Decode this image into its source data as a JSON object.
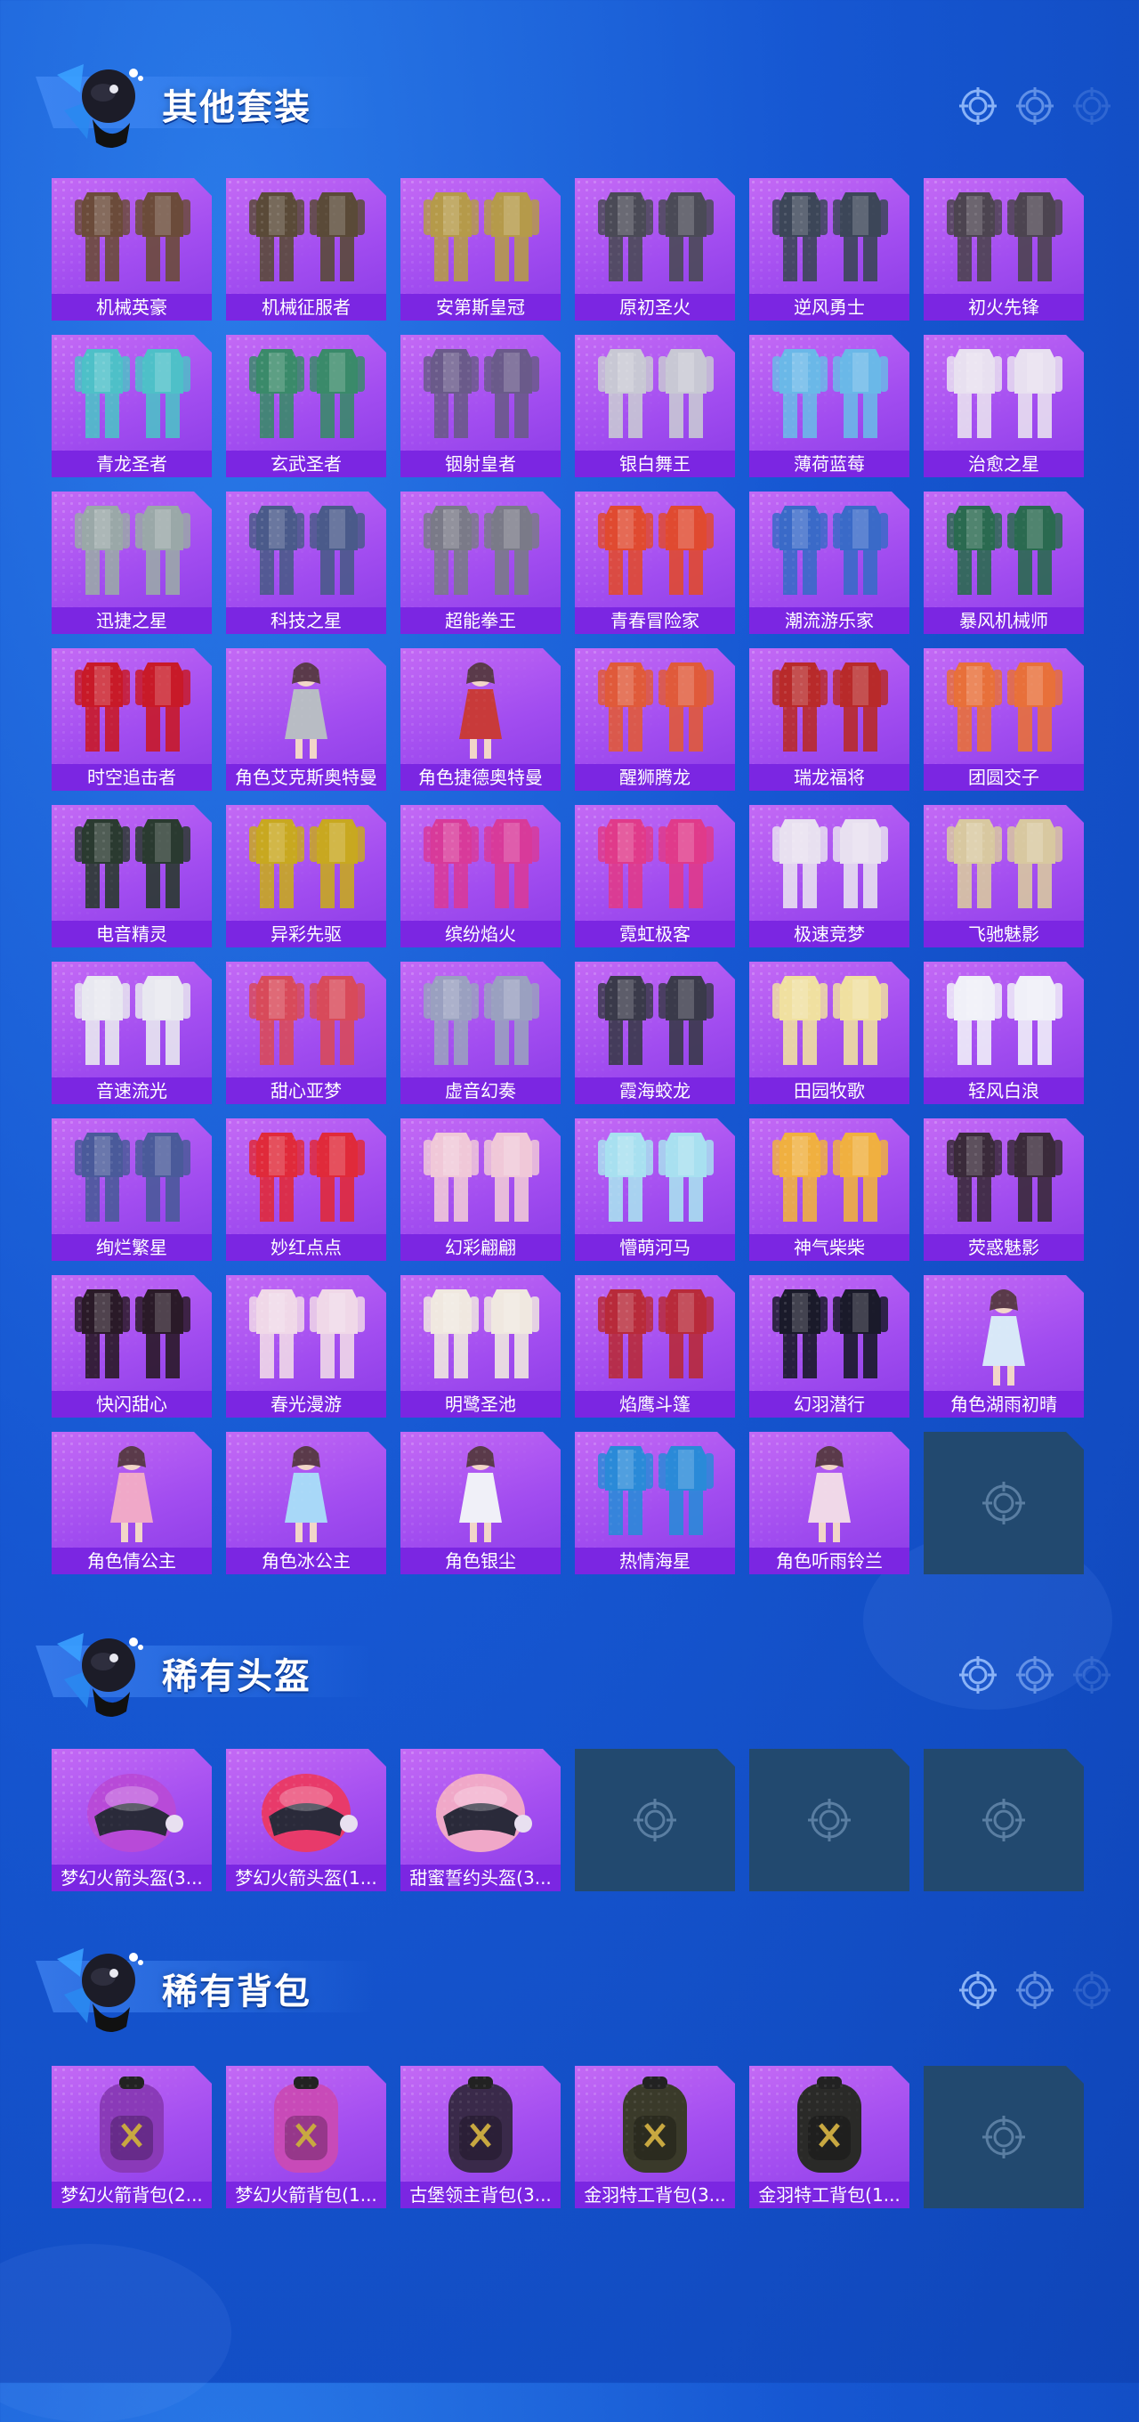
{
  "colors": {
    "background": "#1657d2",
    "card": "#a24df0",
    "label_bar": "#7b26e2",
    "empty_slot": "#22496f"
  },
  "sections": [
    {
      "title": "其他套装",
      "items": [
        {
          "label": "机械英豪",
          "type": "outfit",
          "tone": "#6b4b3a"
        },
        {
          "label": "机械征服者",
          "type": "outfit",
          "tone": "#5a4a38"
        },
        {
          "label": "安第斯皇冠",
          "type": "outfit",
          "tone": "#b59a4a"
        },
        {
          "label": "原初圣火",
          "type": "outfit",
          "tone": "#4a4a56"
        },
        {
          "label": "逆风勇士",
          "type": "outfit",
          "tone": "#3c4658"
        },
        {
          "label": "初火先锋",
          "type": "outfit",
          "tone": "#4c4450"
        },
        {
          "label": "青龙圣者",
          "type": "outfit",
          "tone": "#4ec0c8"
        },
        {
          "label": "玄武圣者",
          "type": "outfit",
          "tone": "#3a8a6a"
        },
        {
          "label": "铟射皇者",
          "type": "outfit",
          "tone": "#6a5a8a"
        },
        {
          "label": "银白舞王",
          "type": "outfit",
          "tone": "#c8c8d4"
        },
        {
          "label": "薄荷蓝莓",
          "type": "outfit",
          "tone": "#6ab8e8"
        },
        {
          "label": "治愈之星",
          "type": "outfit",
          "tone": "#e8e0f0"
        },
        {
          "label": "迅捷之星",
          "type": "outfit",
          "tone": "#9aa8a8"
        },
        {
          "label": "科技之星",
          "type": "outfit",
          "tone": "#4a5a8a"
        },
        {
          "label": "超能拳王",
          "type": "outfit",
          "tone": "#7a7a88"
        },
        {
          "label": "青春冒险家",
          "type": "outfit",
          "tone": "#e04a30"
        },
        {
          "label": "潮流游乐家",
          "type": "outfit",
          "tone": "#3a6ac8"
        },
        {
          "label": "暴风机械师",
          "type": "outfit",
          "tone": "#2a6a50"
        },
        {
          "label": "时空追击者",
          "type": "outfit",
          "tone": "#c81a28"
        },
        {
          "label": "角色艾克斯奥特曼",
          "type": "figure",
          "tone": "#b8bcc4"
        },
        {
          "label": "角色捷德奥特曼",
          "type": "figure",
          "tone": "#c83a3a"
        },
        {
          "label": "醒狮腾龙",
          "type": "outfit",
          "tone": "#e05a3a"
        },
        {
          "label": "瑞龙福将",
          "type": "outfit",
          "tone": "#b82a2a"
        },
        {
          "label": "团圆交子",
          "type": "outfit",
          "tone": "#e8703a"
        },
        {
          "label": "电音精灵",
          "type": "outfit",
          "tone": "#2a3a30"
        },
        {
          "label": "异彩先驱",
          "type": "outfit",
          "tone": "#c8a820"
        },
        {
          "label": "缤纷焰火",
          "type": "outfit",
          "tone": "#d83a9a"
        },
        {
          "label": "霓虹极客",
          "type": "outfit",
          "tone": "#e03a8a"
        },
        {
          "label": "极速竞梦",
          "type": "outfit",
          "tone": "#e8e0f0"
        },
        {
          "label": "飞驰魅影",
          "type": "outfit",
          "tone": "#d8c8a0"
        },
        {
          "label": "音速流光",
          "type": "outfit",
          "tone": "#e8e8f0"
        },
        {
          "label": "甜心亚梦",
          "type": "outfit",
          "tone": "#d84a5a"
        },
        {
          "label": "虚音幻奏",
          "type": "outfit",
          "tone": "#9aa0c0"
        },
        {
          "label": "霞海蛟龙",
          "type": "outfit",
          "tone": "#3a3a4a"
        },
        {
          "label": "田园牧歌",
          "type": "outfit",
          "tone": "#f0e0a0"
        },
        {
          "label": "轻风白浪",
          "type": "outfit",
          "tone": "#f0f0f8"
        },
        {
          "label": "绚烂繁星",
          "type": "outfit",
          "tone": "#4a5a9a"
        },
        {
          "label": "妙红点点",
          "type": "outfit",
          "tone": "#e02a3a"
        },
        {
          "label": "幻彩翩翩",
          "type": "outfit",
          "tone": "#f0c8d8"
        },
        {
          "label": "懵萌河马",
          "type": "outfit",
          "tone": "#a8e0f0"
        },
        {
          "label": "神气柴柴",
          "type": "outfit",
          "tone": "#f0b040"
        },
        {
          "label": "荧惑魅影",
          "type": "outfit",
          "tone": "#3a2a3a"
        },
        {
          "label": "快闪甜心",
          "type": "outfit",
          "tone": "#2a1a28"
        },
        {
          "label": "春光漫游",
          "type": "outfit",
          "tone": "#f0d8e8"
        },
        {
          "label": "明鹭圣池",
          "type": "outfit",
          "tone": "#f0e8e0"
        },
        {
          "label": "焰鹰斗篷",
          "type": "outfit",
          "tone": "#b82a3a"
        },
        {
          "label": "幻羽潜行",
          "type": "outfit",
          "tone": "#1a1a2a"
        },
        {
          "label": "角色湖雨初晴",
          "type": "figure",
          "tone": "#d8e8f8"
        },
        {
          "label": "角色倩公主",
          "type": "figure",
          "tone": "#f0a8c8"
        },
        {
          "label": "角色冰公主",
          "type": "figure",
          "tone": "#a8d8f8"
        },
        {
          "label": "角色银尘",
          "type": "figure",
          "tone": "#f0f0f8"
        },
        {
          "label": "热情海星",
          "type": "outfit",
          "tone": "#2a8ad8"
        },
        {
          "label": "角色听雨铃兰",
          "type": "figure",
          "tone": "#f0d8e8"
        },
        {
          "label": "",
          "type": "empty",
          "tone": ""
        }
      ]
    },
    {
      "title": "稀有头盔",
      "items": [
        {
          "label": "梦幻火箭头盔(3...",
          "type": "helmet",
          "tone": "#b84ad8"
        },
        {
          "label": "梦幻火箭头盔(1...",
          "type": "helmet",
          "tone": "#e83a6a"
        },
        {
          "label": "甜蜜誓约头盔(3...",
          "type": "helmet",
          "tone": "#f0a8c8"
        },
        {
          "label": "",
          "type": "empty",
          "tone": ""
        },
        {
          "label": "",
          "type": "empty",
          "tone": ""
        },
        {
          "label": "",
          "type": "empty",
          "tone": ""
        }
      ]
    },
    {
      "title": "稀有背包",
      "items": [
        {
          "label": "梦幻火箭背包(2...",
          "type": "backpack",
          "tone": "#8a3ab8"
        },
        {
          "label": "梦幻火箭背包(1...",
          "type": "backpack",
          "tone": "#c84ab8"
        },
        {
          "label": "古堡领主背包(3...",
          "type": "backpack",
          "tone": "#3a2a4a"
        },
        {
          "label": "金羽特工背包(3...",
          "type": "backpack",
          "tone": "#3a3a2a"
        },
        {
          "label": "金羽特工背包(1...",
          "type": "backpack",
          "tone": "#2a2a28"
        },
        {
          "label": "",
          "type": "empty",
          "tone": ""
        }
      ]
    }
  ]
}
